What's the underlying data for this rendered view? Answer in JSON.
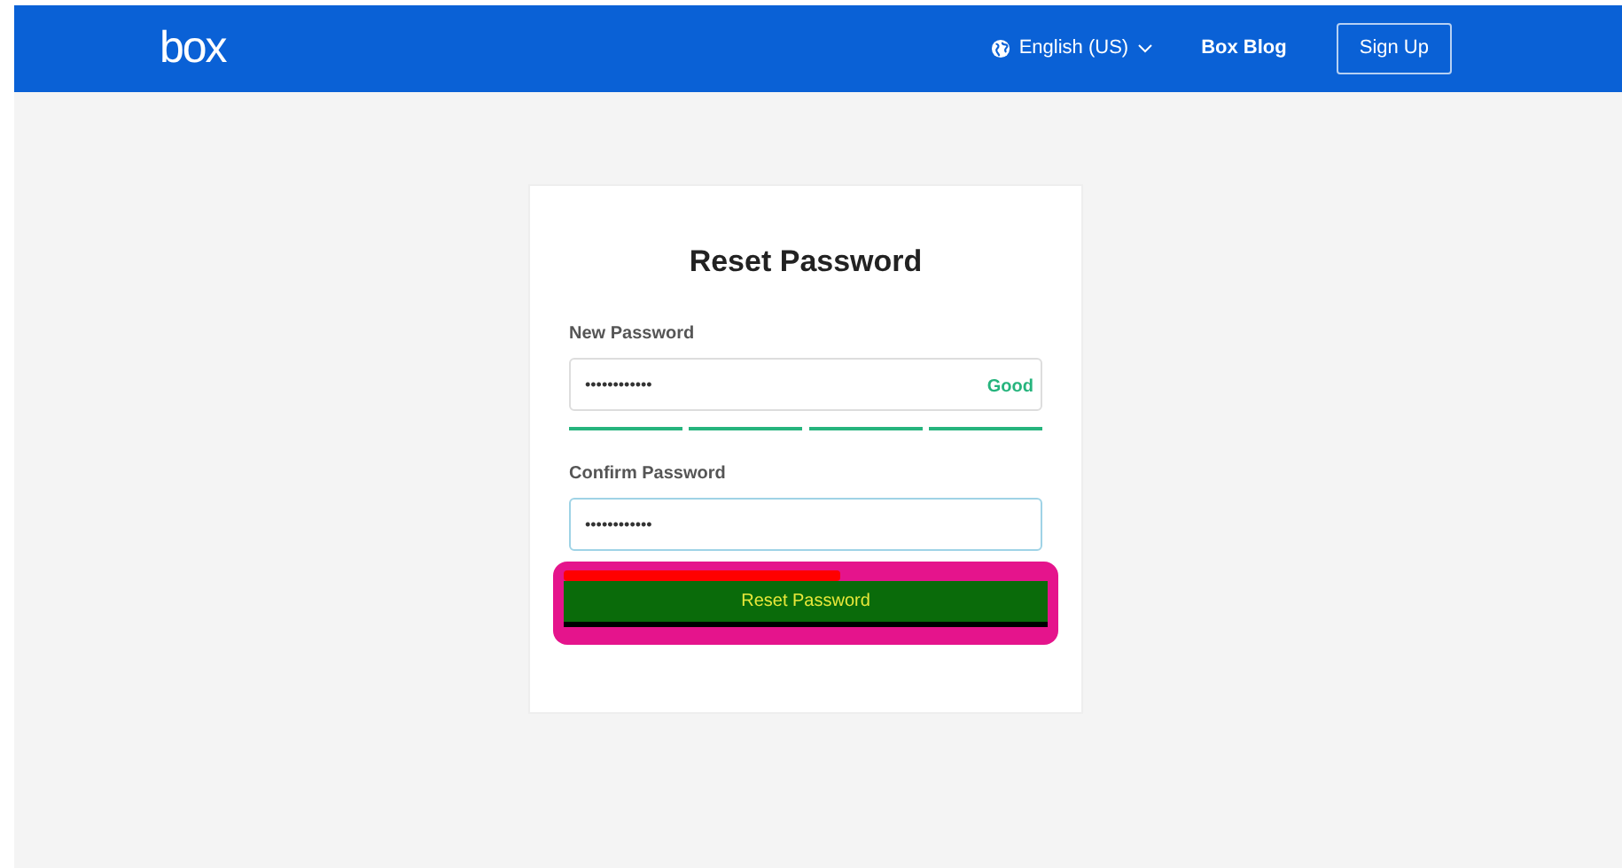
{
  "header": {
    "logo": "box",
    "language": "English (US)",
    "links": [
      "Box Blog"
    ],
    "signup": "Sign Up"
  },
  "form": {
    "title": "Reset Password",
    "new_password": {
      "label": "New Password",
      "value": "••••••••••••",
      "strength": "Good",
      "level": 1
    },
    "confirm_password": {
      "label": "Confirm Password",
      "value": "••••••••••••",
      "focused": true
    },
    "submit": "Reset Password"
  }
}
